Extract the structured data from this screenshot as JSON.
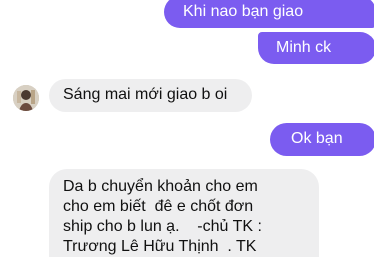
{
  "messages": {
    "m1": "Khi nao bạn giao",
    "m2": "Minh ck",
    "m3": "Sáng mai mới giao b oi",
    "m4": "Ok bạn",
    "m5_lines": [
      "Da b chuyển khoản cho em",
      "cho em biết  đê e chốt đơn",
      "ship cho b lun ạ.    -chủ TK :",
      "Trương Lê Hữu Thịnh  . TK"
    ]
  },
  "colors": {
    "sent_bubble": "#7b5cf0",
    "received_bubble": "#eeeeef",
    "background": "#ffffff"
  },
  "icons": {
    "avatar": "contact-avatar-icon"
  }
}
